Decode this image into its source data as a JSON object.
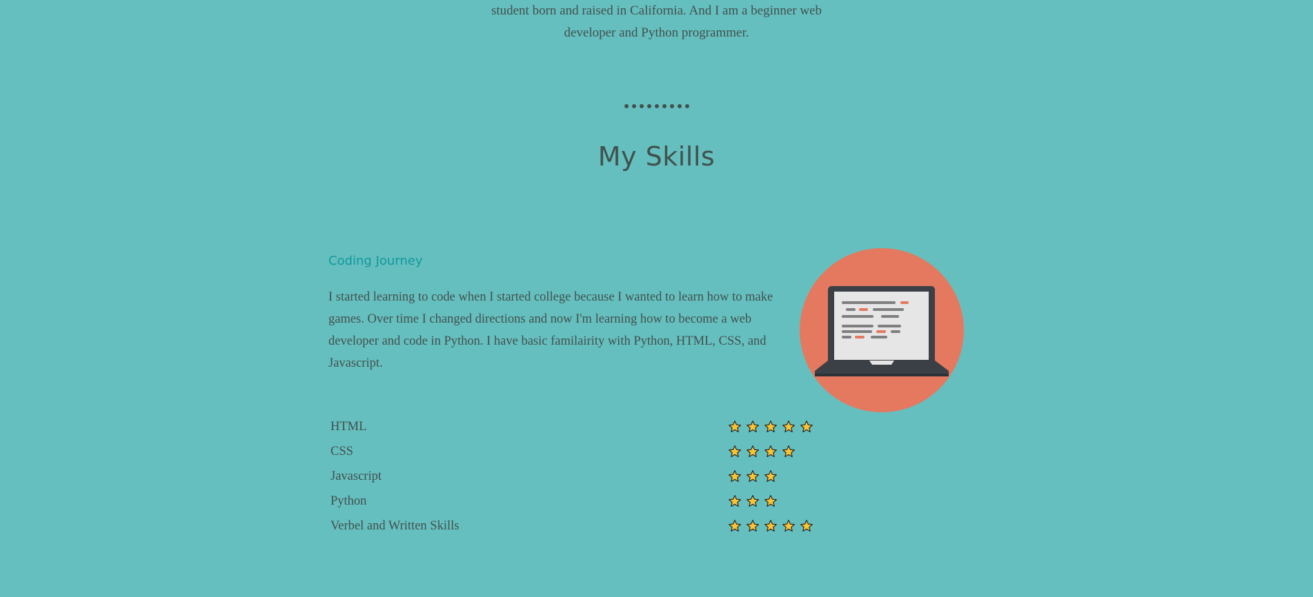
{
  "intro": {
    "line1": "student born and raised in California. And I am a beginner web",
    "line2": "developer and Python programmer."
  },
  "skills_section": {
    "title": "My Skills",
    "subheading": "Coding Journey",
    "paragraph": "I started learning to code when I started college because I wanted to learn how to make games. Over time I changed directions and now I'm learning how to become a web developer and code in Python. I have basic familairity with Python, HTML, CSS, and Javascript.",
    "image_icon": "laptop-icon"
  },
  "skills": [
    {
      "name": "HTML",
      "stars": 5
    },
    {
      "name": "CSS",
      "stars": 4
    },
    {
      "name": "Javascript",
      "stars": 3
    },
    {
      "name": "Python",
      "stars": 3
    },
    {
      "name": "Verbel and Written Skills",
      "stars": 5
    }
  ],
  "colors": {
    "background": "#66bfbf",
    "text": "#40514e",
    "accent": "#11999e",
    "circle": "#e4795f",
    "star": "#f9c535"
  }
}
